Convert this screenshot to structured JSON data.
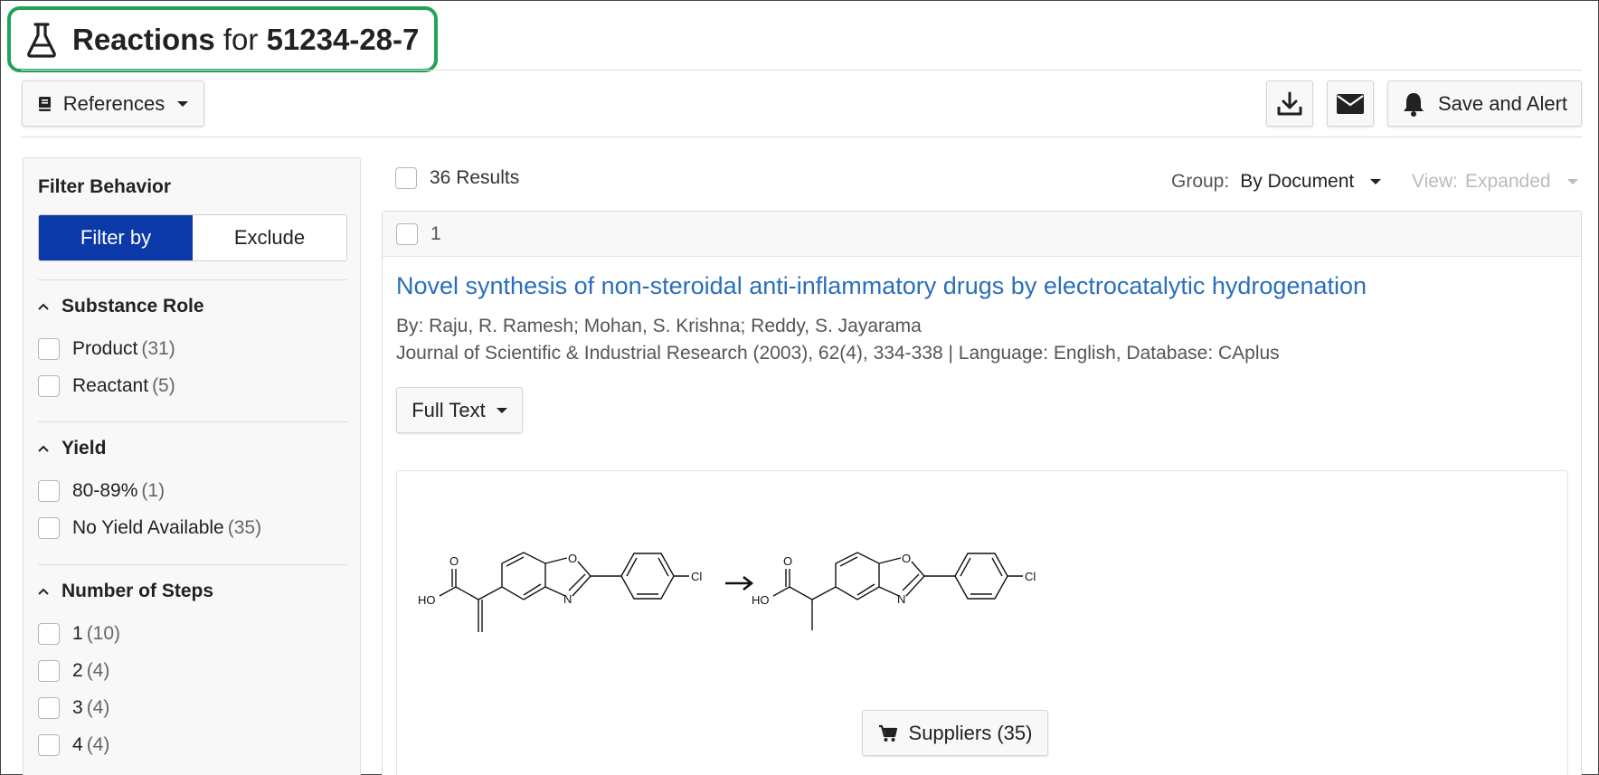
{
  "page": {
    "title_prefix": "Reactions",
    "title_for": "for",
    "title_id": "51234-28-7"
  },
  "toolbar": {
    "references_label": "References",
    "save_alert_label": "Save and Alert"
  },
  "sidebar": {
    "filter_behavior": "Filter Behavior",
    "filter_by": "Filter by",
    "exclude": "Exclude",
    "sections": [
      {
        "title": "Substance Role",
        "options": [
          {
            "label": "Product",
            "count": "(31)"
          },
          {
            "label": "Reactant",
            "count": "(5)"
          }
        ]
      },
      {
        "title": "Yield",
        "options": [
          {
            "label": "80-89%",
            "count": "(1)"
          },
          {
            "label": "No Yield Available",
            "count": "(35)"
          }
        ]
      },
      {
        "title": "Number of Steps",
        "options": [
          {
            "label": "1",
            "count": "(10)"
          },
          {
            "label": "2",
            "count": "(4)"
          },
          {
            "label": "3",
            "count": "(4)"
          },
          {
            "label": "4",
            "count": "(4)"
          }
        ]
      }
    ]
  },
  "results": {
    "count_label": "36 Results",
    "group_label": "Group:",
    "group_value": "By Document",
    "view_label": "View:",
    "view_value": "Expanded"
  },
  "card": {
    "index": "1",
    "title": "Novel synthesis of non-steroidal anti-inflammatory drugs by electrocatalytic hydrogenation",
    "authors": "By: Raju, R. Ramesh; Mohan, S. Krishna; Reddy, S. Jayarama",
    "source": "Journal of Scientific & Industrial Research (2003), 62(4), 334-338 | Language: English, Database: CAplus",
    "full_text_label": "Full Text",
    "suppliers_label": "Suppliers (35)",
    "structure_labels": {
      "o": "O",
      "n": "N",
      "cl": "Cl",
      "ho": "HO"
    }
  },
  "colors": {
    "accent_green": "#21a35a",
    "primary_blue": "#0b3aa8",
    "link_blue": "#2a6ebb"
  }
}
